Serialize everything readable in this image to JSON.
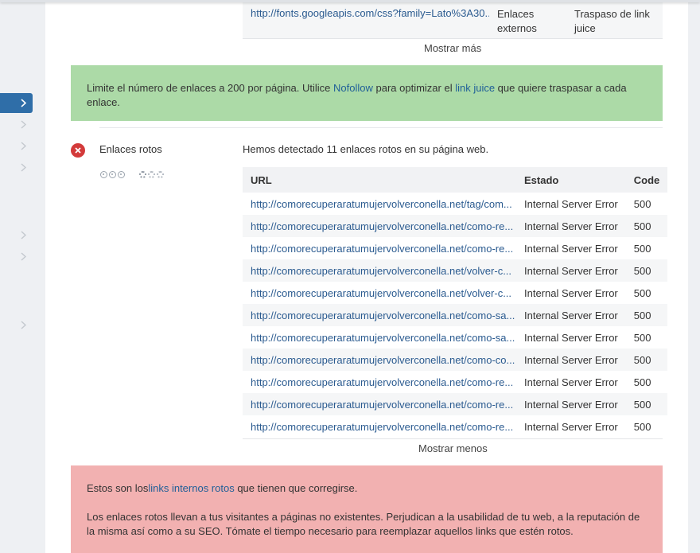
{
  "top_table": {
    "url": "http://fonts.googleapis.com/css?family=Lato%3A30...",
    "type": "Enlaces externos",
    "juice": "Traspaso de link juice",
    "more_label": "Mostrar más"
  },
  "alert_green": {
    "text_before": "Limite el número de enlaces a 200 por página. Utilice ",
    "link_nofollow": "Nofollow",
    "text_middle": " para optimizar el ",
    "link_juice": "link juice",
    "text_after": " que quiere traspasar a cada enlace."
  },
  "broken_links": {
    "title": "Enlaces rotos",
    "intro": "Hemos detectado 11 enlaces rotos en su página web.",
    "headers": {
      "url": "URL",
      "state": "Estado",
      "code": "Code"
    },
    "rows": [
      {
        "url": "http://comorecuperaratumujervolverconella.net/tag/com...",
        "state": "Internal Server Error",
        "code": "500"
      },
      {
        "url": "http://comorecuperaratumujervolverconella.net/como-re...",
        "state": "Internal Server Error",
        "code": "500"
      },
      {
        "url": "http://comorecuperaratumujervolverconella.net/como-re...",
        "state": "Internal Server Error",
        "code": "500"
      },
      {
        "url": "http://comorecuperaratumujervolverconella.net/volver-c...",
        "state": "Internal Server Error",
        "code": "500"
      },
      {
        "url": "http://comorecuperaratumujervolverconella.net/volver-c...",
        "state": "Internal Server Error",
        "code": "500"
      },
      {
        "url": "http://comorecuperaratumujervolverconella.net/como-sa...",
        "state": "Internal Server Error",
        "code": "500"
      },
      {
        "url": "http://comorecuperaratumujervolverconella.net/como-sa...",
        "state": "Internal Server Error",
        "code": "500"
      },
      {
        "url": "http://comorecuperaratumujervolverconella.net/como-co...",
        "state": "Internal Server Error",
        "code": "500"
      },
      {
        "url": "http://comorecuperaratumujervolverconella.net/como-re...",
        "state": "Internal Server Error",
        "code": "500"
      },
      {
        "url": "http://comorecuperaratumujervolverconella.net/como-re...",
        "state": "Internal Server Error",
        "code": "500"
      },
      {
        "url": "http://comorecuperaratumujervolverconella.net/como-re...",
        "state": "Internal Server Error",
        "code": "500"
      }
    ],
    "less_label": "Mostrar menos"
  },
  "alert_red": {
    "p1_before": "Estos son los",
    "p1_link": "links internos rotos",
    "p1_after": " que tienen que corregirse.",
    "p2": "Los enlaces rotos llevan a tus visitantes a páginas no existentes. Perjudican a la usabilidad de tu web, a la reputación de la misma así como a su SEO. Tómate el tiempo necesario para reemplazar aquellos links que estén rotos."
  },
  "icons": {
    "sidebar_active": "chevron-right-icon",
    "sidebar_items": "chevron-right-icon",
    "status": "error-icon"
  },
  "colors": {
    "accent": "#2f6ea8",
    "success_bg": "#acdaa7",
    "error_bg": "#f2b1b1",
    "error_icon": "#d33a3a",
    "link": "#2b5b90"
  }
}
